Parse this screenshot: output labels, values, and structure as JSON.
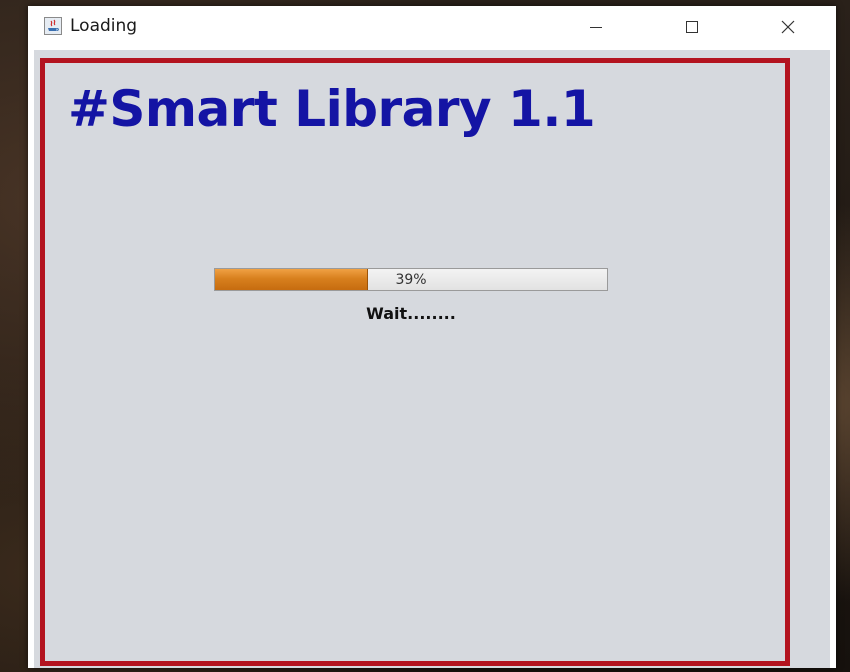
{
  "window": {
    "title": "Loading",
    "icon": "java-app-icon",
    "controls": {
      "minimize_icon": "minimize-icon",
      "maximize_icon": "maximize-icon",
      "close_icon": "close-icon"
    }
  },
  "content": {
    "heading": "#Smart Library 1.1",
    "progress": {
      "value_percent": 39,
      "label": "39%"
    },
    "status_text": "Wait........"
  },
  "colors": {
    "heading": "#1414a4",
    "border": "#b3131f",
    "progress_fill": "#d8801e",
    "client_background": "#d6d9de"
  }
}
